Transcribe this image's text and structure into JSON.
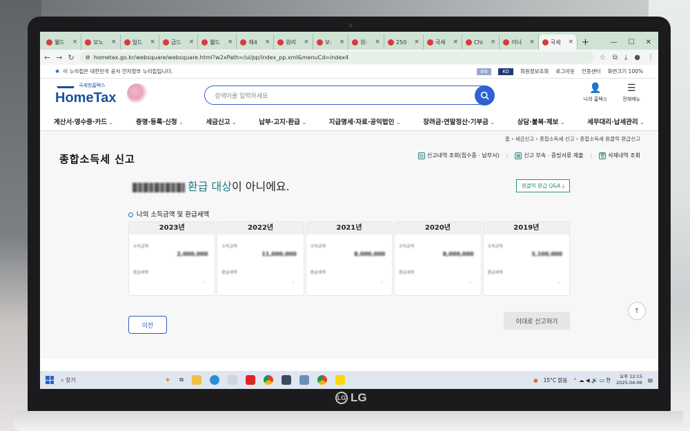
{
  "browser": {
    "tabs": [
      {
        "label": "웰드",
        "active": false
      },
      {
        "label": "모노",
        "active": false
      },
      {
        "label": "일드",
        "active": false
      },
      {
        "label": "금드",
        "active": false
      },
      {
        "label": "웰드",
        "active": false
      },
      {
        "label": "제4",
        "active": false
      },
      {
        "label": "원리",
        "active": false
      },
      {
        "label": "보:",
        "active": false
      },
      {
        "label": "원:",
        "active": false
      },
      {
        "label": "250",
        "active": false
      },
      {
        "label": "국세",
        "active": false
      },
      {
        "label": "Chi",
        "active": false
      },
      {
        "label": "이너",
        "active": false
      },
      {
        "label": "국세",
        "active": true
      }
    ],
    "url": "hometax.go.kr/websquare/websquare.html?w2xPath=/ui/pp/index_pp.xml&menuCd=index4"
  },
  "gov_banner": {
    "text": "이 누리집은 대한민국 공식 전자정부 누리집입니다.",
    "links": [
      "회원정보조회",
      "로그아웃",
      "인증센터",
      "화면크기 100%"
    ]
  },
  "header": {
    "logo_sub": "국세청홈택스",
    "logo_main": "HomeTax",
    "search_placeholder": "검색어를 입력하세요",
    "my_hometax": "나의 홈택스",
    "all_menu": "전체메뉴"
  },
  "nav": {
    "items": [
      "계산서·영수증·카드",
      "증명·등록·신청",
      "세금신고",
      "납부·고지·환급",
      "지급명세·자료·공익법인",
      "장려금·연말정산·기부금",
      "상담·불복·제보",
      "세무대리·납세관리"
    ]
  },
  "breadcrumb": "홈 › 세금신고 › 종합소득세 신고 › 종합소득세 원클릭 환급신고",
  "page": {
    "title": "종합소득세 신고",
    "actions": [
      "신고내역 조회(접수증 · 납부서)",
      "신고 부속 · 증빙서류 제출",
      "삭제내역 조회"
    ],
    "message_highlight": "환급 대상",
    "message_tail": "이 아니에요.",
    "qa_button": "원클릭 환급 Q&A",
    "subhead": "나의 소득금액 및 환급세액",
    "years": [
      {
        "year": "2023년",
        "label1": "소득금액",
        "value1": "2,000,000",
        "label2": "환급세액",
        "value2": "-"
      },
      {
        "year": "2022년",
        "label1": "소득금액",
        "value1": "11,000,000",
        "label2": "환급세액",
        "value2": "-"
      },
      {
        "year": "2021년",
        "label1": "소득금액",
        "value1": "8,000,000",
        "label2": "환급세액",
        "value2": "-"
      },
      {
        "year": "2020년",
        "label1": "소득금액",
        "value1": "8,000,000",
        "label2": "환급세액",
        "value2": "-"
      },
      {
        "year": "2019년",
        "label1": "소득금액",
        "value1": "3,100,000",
        "label2": "환급세액",
        "value2": "-"
      }
    ],
    "prev_button": "이전",
    "file_button": "이대로 신고하기"
  },
  "taskbar": {
    "search": "찾기",
    "weather": "15°C  맑음",
    "time": "오후 12:15",
    "date": "2025-04-06"
  },
  "device": {
    "brand": "LG"
  }
}
